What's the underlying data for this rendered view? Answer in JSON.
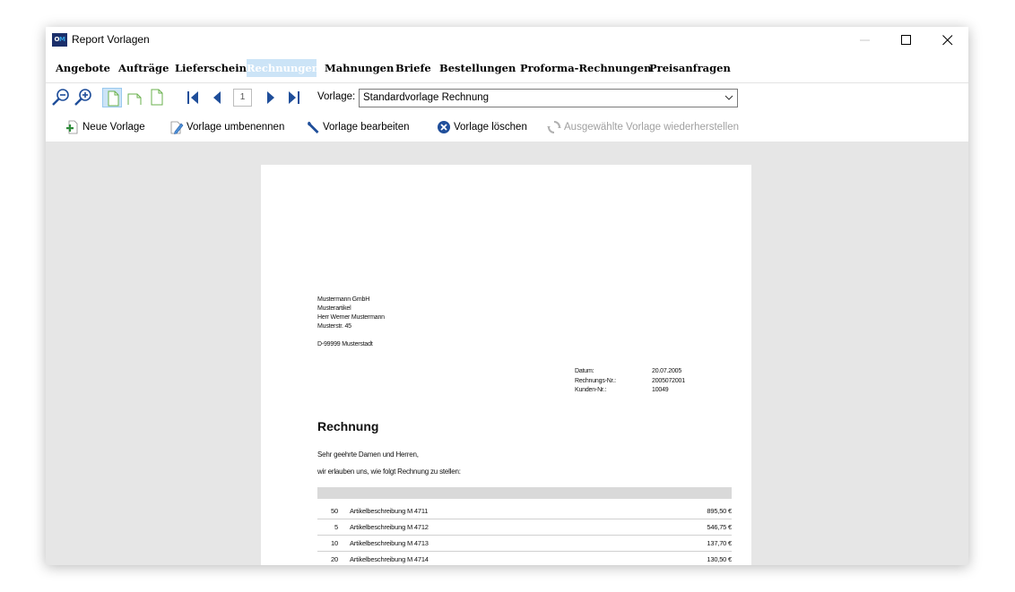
{
  "window": {
    "title": "Report Vorlagen",
    "app_icon_text_left": "O",
    "app_icon_text_right": "M"
  },
  "tabs": [
    {
      "label": "Angebote"
    },
    {
      "label": "Aufträge"
    },
    {
      "label": "Lieferscheine"
    },
    {
      "label": "Rechnungen",
      "active": true
    },
    {
      "label": "Mahnungen"
    },
    {
      "label": "Briefe"
    },
    {
      "label": "Bestellungen"
    },
    {
      "label": "Proforma-Rechnungen"
    },
    {
      "label": "Preisanfragen"
    }
  ],
  "toolbar": {
    "icons": [
      "zoom-out-icon",
      "zoom-in-icon",
      "page-full-icon",
      "page-right-icon",
      "page-left-icon",
      "first-page-icon",
      "prev-page-icon",
      "next-page-icon",
      "last-page-icon"
    ],
    "page_number": "1",
    "vorlage_label": "Vorlage:",
    "vorlage_value": "Standardvorlage Rechnung"
  },
  "actions": {
    "new": "Neue Vorlage",
    "rename": "Vorlage umbenennen",
    "edit": "Vorlage bearbeiten",
    "delete": "Vorlage löschen",
    "restore": "Ausgewählte Vorlage wiederherstellen"
  },
  "document": {
    "address": {
      "line1": "Mustermann GmbH",
      "line2": "Musterartikel",
      "line3": "Herr Werner Mustermann",
      "line4": "Musterstr. 45",
      "line5": "D-99999 Musterstadt"
    },
    "meta": {
      "date_label": "Datum:",
      "date_value": "20.07.2005",
      "invoice_label": "Rechnungs-Nr.:",
      "invoice_value": "2005072001",
      "customer_label": "Kunden-Nr.:",
      "customer_value": "10049"
    },
    "title": "Rechnung",
    "greeting": "Sehr geehrte Damen und Herren,",
    "intro": "wir erlauben uns, wie folgt Rechnung zu stellen:",
    "items": [
      {
        "qty": "50",
        "desc": "Artikelbeschreibung M 4711",
        "price": "895,50 €"
      },
      {
        "qty": "5",
        "desc": "Artikelbeschreibung M 4712",
        "price": "546,75 €"
      },
      {
        "qty": "10",
        "desc": "Artikelbeschreibung M 4713",
        "price": "137,70 €"
      },
      {
        "qty": "20",
        "desc": "Artikelbeschreibung M 4714",
        "price": "130,50 €"
      }
    ]
  },
  "colors": {
    "active_tab": "#cce4f7",
    "preview_bg": "#e6e6e6",
    "app_icon": "#1b2f6b"
  }
}
